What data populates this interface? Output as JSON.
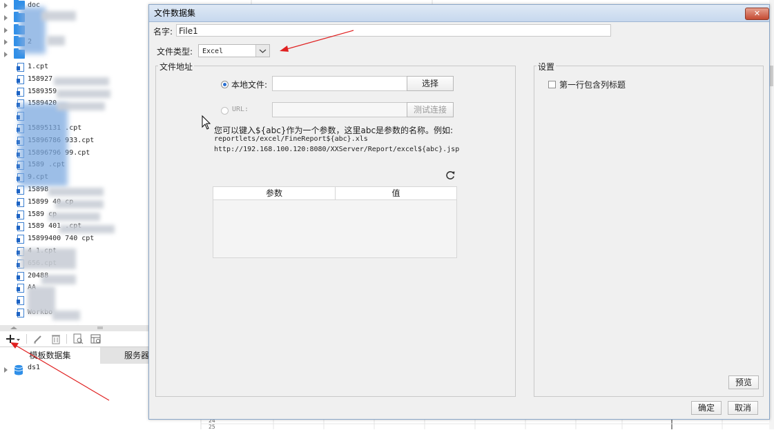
{
  "tree": {
    "folders": [
      {
        "label": "doc"
      },
      {
        "label": ""
      },
      {
        "label": ""
      },
      {
        "label": "2"
      },
      {
        "label": ""
      }
    ],
    "files": [
      {
        "label": "1.cpt"
      },
      {
        "label": "158927"
      },
      {
        "label": "1589359"
      },
      {
        "label": "1589420"
      },
      {
        "label": ""
      },
      {
        "label": "15895131    .cpt"
      },
      {
        "label": "15896786     933.cpt"
      },
      {
        "label": "15896796     99.cpt"
      },
      {
        "label": "1589      .cpt"
      },
      {
        "label": "          9.cpt"
      },
      {
        "label": "15898"
      },
      {
        "label": "15899      40     cp"
      },
      {
        "label": "1589          cp"
      },
      {
        "label": "1589       401      .cpt"
      },
      {
        "label": "15899400    740    cpt"
      },
      {
        "label": "          4     1.cpt"
      },
      {
        "label": "            656.cpt"
      },
      {
        "label": "20488"
      },
      {
        "label": "AA"
      },
      {
        "label": ""
      },
      {
        "label": "Workbo"
      }
    ]
  },
  "left_tabs": {
    "tab1": "模板数据集",
    "tab2": "服务器"
  },
  "datasets": [
    {
      "label": "ds1"
    }
  ],
  "sheet": {
    "row_a": "24",
    "row_b": "25"
  },
  "dialog": {
    "title": "文件数据集",
    "close_symbol": "✕",
    "name_label": "名字:",
    "name_value": "File1",
    "file_type_label": "文件类型:",
    "file_type_value": "Excel",
    "address_group": "文件地址",
    "local_file_label": "本地文件:",
    "local_file_value": "",
    "choose_button": "选择",
    "url_label": "URL:",
    "url_value": "",
    "test_button": "测试连接",
    "hint_line1": "您可以键入${abc}作为一个参数，这里abc是参数的名称。例如:",
    "hint_line2": "reportlets/excel/FineReport${abc}.xls",
    "hint_line3": "http://192.168.100.120:8080/XXServer/Report/excel${abc}.jsp",
    "param_header": "参数",
    "value_header": "值",
    "settings_group": "设置",
    "first_row_header": "第一行包含列标题",
    "preview_button": "预览",
    "ok_button": "确定",
    "cancel_button": "取消"
  },
  "colors": {
    "accent": "#2a6fd1",
    "folder": "#2f8fe8",
    "annotation_arrow": "#e02020"
  }
}
